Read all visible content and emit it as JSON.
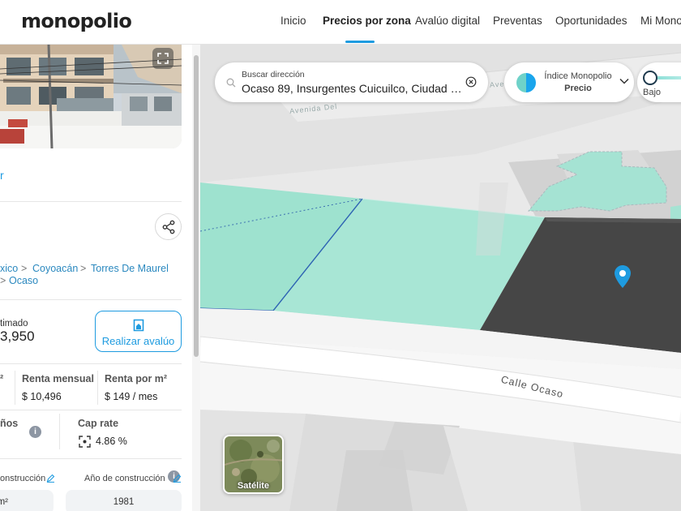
{
  "nav": {
    "logo": "monopolio",
    "items": [
      {
        "label": "Inicio"
      },
      {
        "label": "Precios por zona"
      },
      {
        "label": "Avalúo digital"
      },
      {
        "label": "Preventas"
      },
      {
        "label": "Oportunidades"
      },
      {
        "label": "Mi Mono"
      }
    ],
    "active_index": 1
  },
  "panel": {
    "link_partial": "r",
    "breadcrumb": {
      "items": [
        "xico",
        "Coyoacán",
        "Torres De Maurel",
        "Ocaso"
      ]
    },
    "estimate": {
      "label": "timado",
      "value": "3,950"
    },
    "avaluo_button": "Realizar avalúo",
    "stats_row1": [
      {
        "label": "²",
        "value": ""
      },
      {
        "label": "Renta mensual",
        "value": "$ 10,496"
      },
      {
        "label": "Renta por m²",
        "value": "$ 149 / mes"
      }
    ],
    "stats_row2": [
      {
        "label": "ños",
        "value": ""
      },
      {
        "label": "Cap rate",
        "value": "4.86 %"
      }
    ],
    "fields": [
      {
        "label": "onstrucción",
        "value": "m²"
      },
      {
        "label": "Año de construcción",
        "value": "1981"
      }
    ]
  },
  "map": {
    "search": {
      "label": "Buscar dirección",
      "value": "Ocaso 89, Insurgentes Cuicuilco, Ciudad de México"
    },
    "index_selector": {
      "title": "Índice Monopolio",
      "value": "Precio"
    },
    "range": {
      "low_label": "Bajo"
    },
    "street_labels": {
      "calle": "Calle Ocaso",
      "avenida": "Avenida Del",
      "ave_short": "Ave"
    },
    "satellite_label": "Satélite"
  },
  "colors": {
    "accent": "#1e9be0",
    "parcel_fill": "#a8e6d5",
    "selected_building": "#474747",
    "pin": "#1e9be0"
  }
}
